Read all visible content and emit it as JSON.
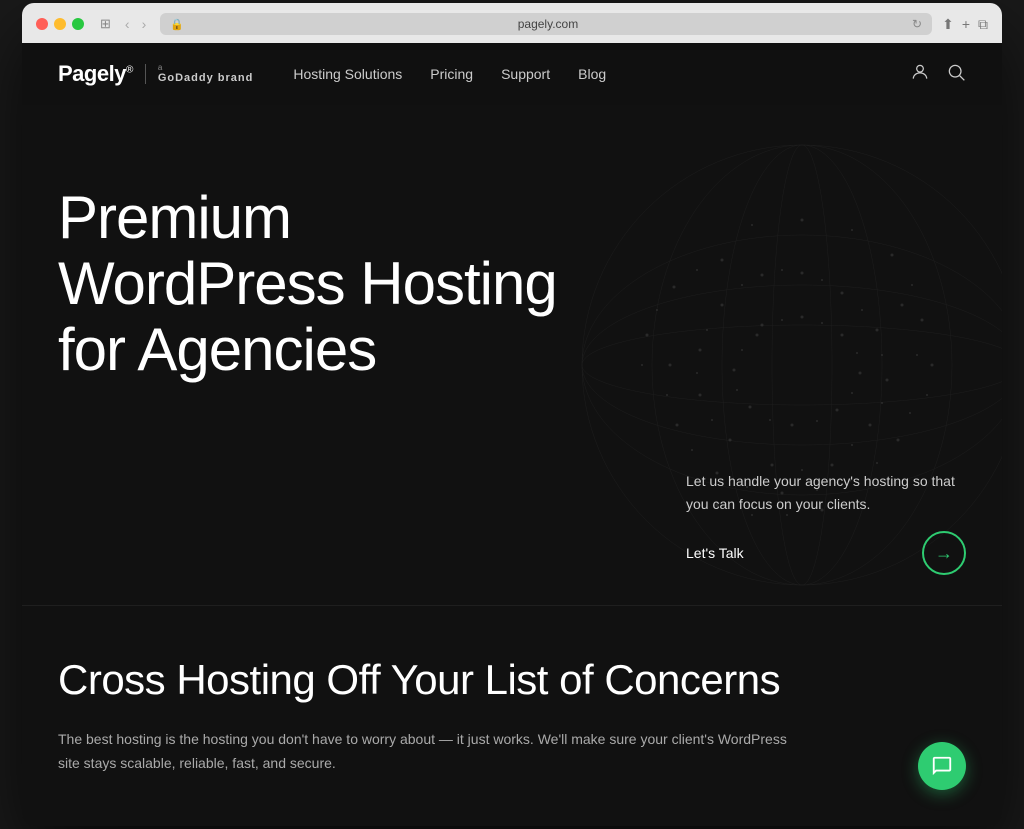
{
  "browser": {
    "url": "pagely.com",
    "traffic_lights": [
      "red",
      "yellow",
      "green"
    ]
  },
  "site": {
    "logo": {
      "name": "Pagely",
      "trademark": "®",
      "godaddy_a": "a",
      "godaddy_brand": "GoDaddy brand"
    },
    "nav": {
      "items": [
        {
          "label": "Hosting Solutions",
          "href": "#"
        },
        {
          "label": "Pricing",
          "href": "#"
        },
        {
          "label": "Support",
          "href": "#"
        },
        {
          "label": "Blog",
          "href": "#"
        }
      ]
    },
    "header_icons": {
      "account": "👤",
      "search": "🔍"
    },
    "hero": {
      "title_line1": "Premium",
      "title_line2": "WordPress Hosting",
      "title_line3": "for Agencies",
      "subtitle": "Let us handle your agency's hosting so that you can focus on your clients.",
      "cta_label": "Let's Talk",
      "cta_arrow": "→"
    },
    "second_section": {
      "heading": "Cross Hosting Off Your List of Concerns",
      "description": "The best hosting is the hosting you don't have to worry about — it just works. We'll make sure your client's WordPress site stays scalable, reliable, fast, and secure."
    },
    "chat": {
      "icon": "💬"
    },
    "colors": {
      "accent_green": "#2ecc71",
      "background": "#111111",
      "text_primary": "#ffffff",
      "text_secondary": "#cccccc",
      "text_muted": "#aaaaaa"
    }
  }
}
